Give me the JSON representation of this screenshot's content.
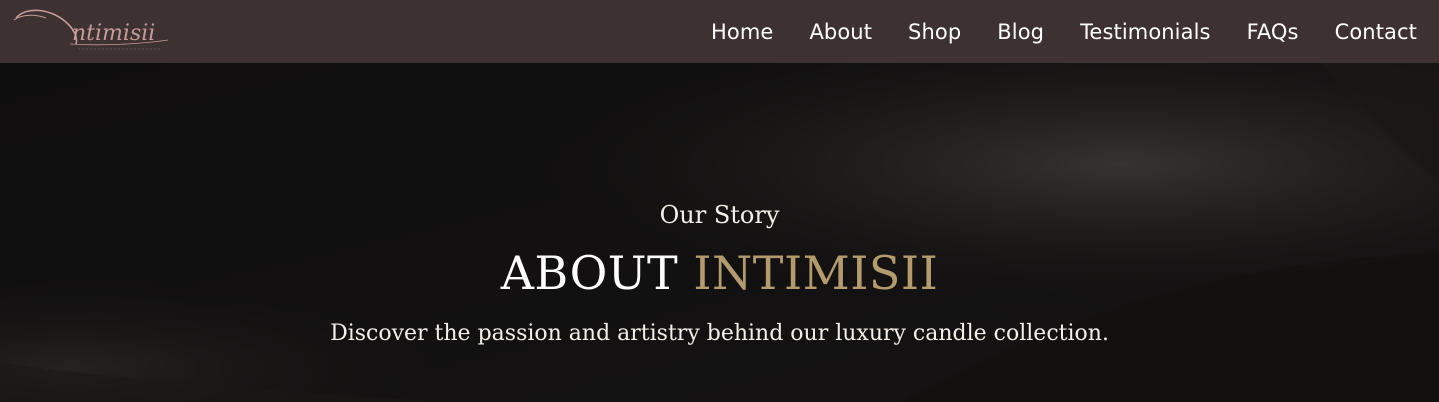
{
  "brand": {
    "logo_text": "intimisii",
    "logo_color": "#c69a98"
  },
  "nav": {
    "items": [
      {
        "label": "Home"
      },
      {
        "label": "About"
      },
      {
        "label": "Shop"
      },
      {
        "label": "Blog"
      },
      {
        "label": "Testimonials"
      },
      {
        "label": "FAQs"
      },
      {
        "label": "Contact"
      }
    ]
  },
  "hero": {
    "eyebrow": "Our Story",
    "title_part1": "ABOUT",
    "title_part2": "INTIMISII",
    "subtitle": "Discover the passion and artistry behind our luxury candle collection."
  },
  "colors": {
    "header_bg": "#3d3132",
    "hero_bg": "#0f0e0e",
    "accent_gold": "#b39b6e",
    "text_light": "#f3efe9"
  }
}
